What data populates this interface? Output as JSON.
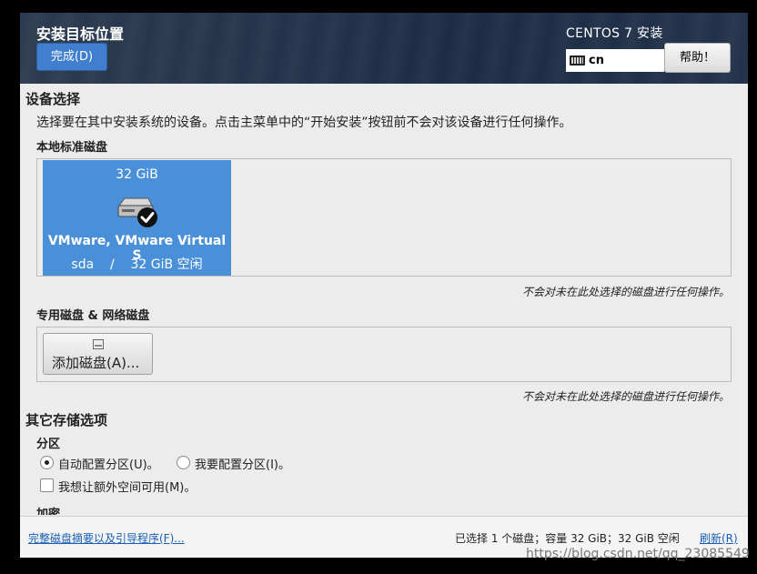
{
  "header": {
    "title": "安装目标位置",
    "done_label": "完成(D)",
    "product": "CENTOS 7 安装",
    "keyboard_layout": "cn",
    "help_label": "帮助！"
  },
  "device_selection": {
    "heading": "设备选择",
    "description": "选择要在其中安装系统的设备。点击主菜单中的“开始安装”按钮前不会对该设备进行任何操作。",
    "local_disks": {
      "heading": "本地标准磁盘",
      "disks": [
        {
          "size": "32 GiB",
          "name": "VMware, VMware Virtual S",
          "device": "sda",
          "separator": "/",
          "free": "32 GiB 空闲",
          "selected": true
        }
      ],
      "note": "不会对未在此处选择的磁盘进行任何操作。"
    },
    "specialized_disks": {
      "heading": "专用磁盘 & 网络磁盘",
      "add_button_label": "添加磁盘(A)...",
      "note": "不会对未在此处选择的磁盘进行任何操作。"
    }
  },
  "other_storage": {
    "heading": "其它存储选项",
    "partition_heading": "分区",
    "auto_label": "自动配置分区(U)。",
    "manual_label": "我要配置分区(I)。",
    "selected_partitioning": "auto",
    "extra_space_label": "我想让额外空间可用(M)。",
    "extra_space_checked": false,
    "encryption_heading": "加密"
  },
  "footer": {
    "summary_link": "完整磁盘摘要以及引导程序(F)...",
    "status": "已选择 1 个磁盘；容量 32 GiB；32 GiB 空闲",
    "refresh_link": "刷新(R)"
  },
  "watermark": "https://blog.csdn.net/qq_23085549",
  "colors": {
    "accent": "#4a90d9",
    "header_bg": "#22324a",
    "link": "#1a5fb4"
  }
}
